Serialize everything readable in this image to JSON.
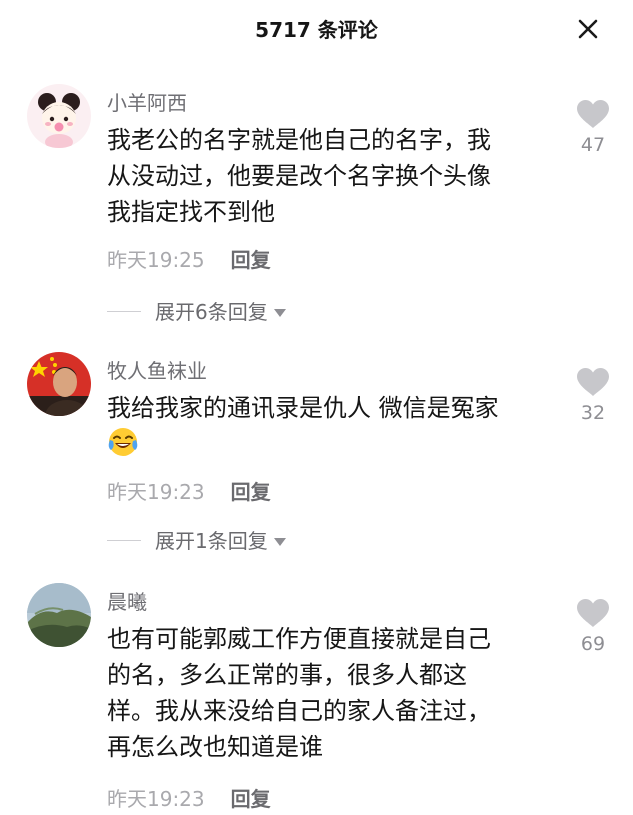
{
  "header": {
    "title": "5717 条评论"
  },
  "comments": [
    {
      "username": "小羊阿西",
      "lines": [
        "我老公的名字就是他自己的名字，我",
        "从没动过，他要是改个名字换个头像",
        "我指定找不到他"
      ],
      "time": "昨天19:25",
      "reply_label": "回复",
      "likes": "47",
      "expand_label": "展开6条回复"
    },
    {
      "username": "牧人鱼袜业",
      "lines": [
        "我给我家的通讯录是仇人 微信是冤家"
      ],
      "emoji": "tears-of-joy-emoji",
      "time": "昨天19:23",
      "reply_label": "回复",
      "likes": "32",
      "expand_label": "展开1条回复"
    },
    {
      "username": "晨曦",
      "lines": [
        "也有可能郭威工作方便直接就是自己",
        "的名，多么正常的事，很多人都这",
        "样。我从来没给自己的家人备注过，",
        "再怎么改也知道是谁"
      ],
      "time": "昨天19:23",
      "reply_label": "回复",
      "likes": "69"
    }
  ],
  "icons": {
    "close": "close-icon",
    "like": "heart-icon",
    "expand": "caret-down-icon"
  },
  "colors": {
    "text_primary": "#161616",
    "username": "#6f6f74",
    "timestamp": "#a9a9ad",
    "heart": "#c7c7cb"
  }
}
